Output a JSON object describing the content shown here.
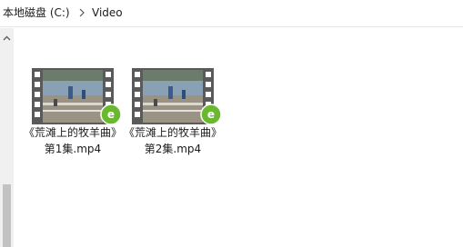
{
  "breadcrumb": {
    "drive": "本地磁盘 (C:)",
    "folder": "Video"
  },
  "files": [
    {
      "name": "《荒滩上的牧羊曲》 第1集.mp4",
      "thumbnail": "video-thumbnail-icon",
      "badge": "player-app-icon"
    },
    {
      "name": "《荒滩上的牧羊曲》 第2集.mp4",
      "thumbnail": "video-thumbnail-icon",
      "badge": "player-app-icon"
    }
  ],
  "colors": {
    "filmstrip": "#5a5a5a",
    "badge": "#6ab82e",
    "breadcrumb_text": "#1b1b1b",
    "scrollbar_track": "#f0f0f0",
    "scrollbar_thumb": "#c2c2c2"
  }
}
